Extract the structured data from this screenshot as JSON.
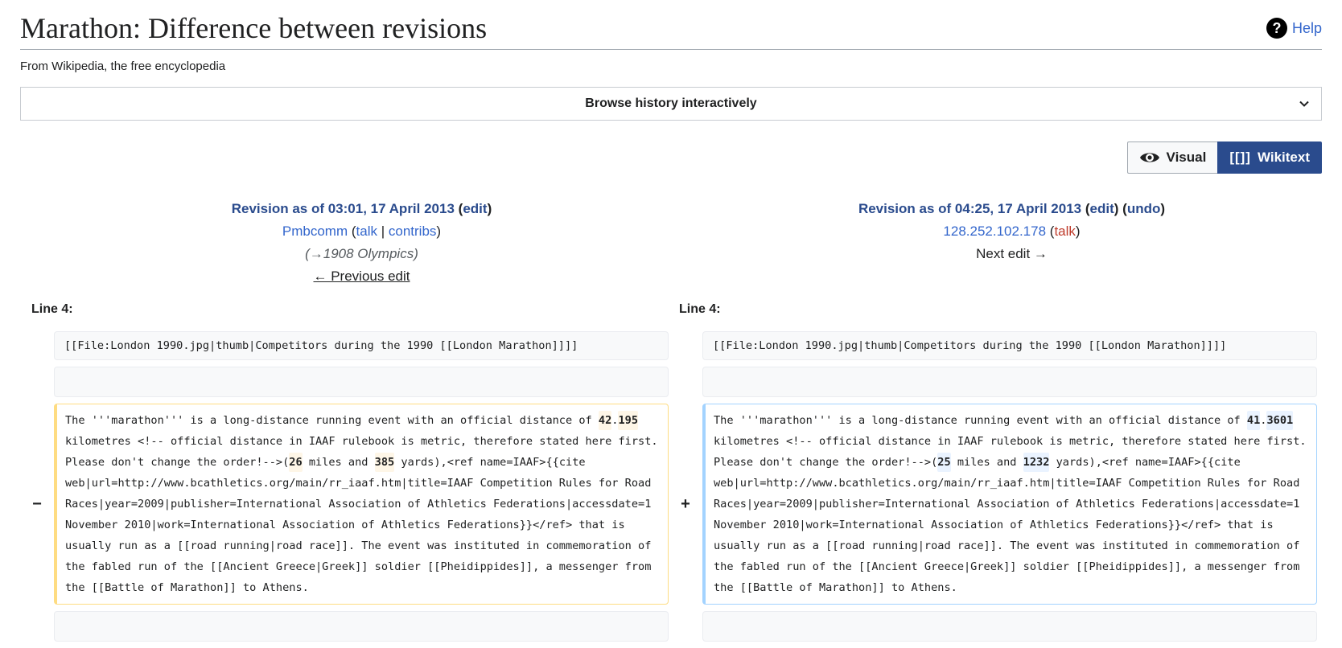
{
  "header": {
    "title": "Marathon: Difference between revisions",
    "help_label": "Help",
    "help_icon": "question-circle-icon",
    "tagline": "From Wikipedia, the free encyclopedia"
  },
  "browse_history": {
    "label": "Browse history interactively",
    "icon": "chevron-down-icon"
  },
  "mode_toggle": {
    "visual_label": "Visual",
    "visual_icon": "eye-icon",
    "wikitext_icon_text": "[[]]",
    "wikitext_label": "Wikitext",
    "selected": "Wikitext"
  },
  "old_revision": {
    "title": "Revision as of 03:01, 17 April 2013",
    "edit_label": "edit",
    "user": "Pmbcomm",
    "talk_label": "talk",
    "separator": "|",
    "contribs_label": "contribs",
    "summary": "(→1908 Olympics)",
    "nav_label": "← Previous edit"
  },
  "new_revision": {
    "title": "Revision as of 04:25, 17 April 2013",
    "edit_label": "edit",
    "undo_label": "undo",
    "user": "128.252.102.178",
    "talk_label": "talk",
    "nav_label": "Next edit →"
  },
  "diff": {
    "left_line_label": "Line 4:",
    "right_line_label": "Line 4:",
    "context_line": "[[File:London 1990.jpg|thumb|Competitors during the 1990 [[London Marathon]]]]",
    "deleted_marker": "−",
    "added_marker": "+",
    "deleted": {
      "t1": "The '''marathon''' is a long-distance running event with an official distance of ",
      "w1": "42",
      "t2": ".",
      "w2": "195",
      "t3": " kilometres <!-- official distance in IAAF rulebook is metric, therefore stated here first. Please don't change the order!-->(",
      "w3": "26",
      "t4": " miles and ",
      "w4": "385",
      "t5": " yards),<ref name=IAAF>{{cite web|url=http://www.bcathletics.org/main/rr_iaaf.htm|title=IAAF Competition Rules for Road Races|year=2009|publisher=International Association of Athletics Federations|accessdate=1 November 2010|work=International Association of Athletics Federations}}</ref> that is usually run as a [[road running|road race]]. The event was instituted in commemoration of the fabled run of the [[Ancient Greece|Greek]] soldier [[Pheidippides]], a messenger from the [[Battle of Marathon]] to Athens."
    },
    "added": {
      "t1": "The '''marathon''' is a long-distance running event with an official distance of ",
      "w1": "41",
      "t2": ".",
      "w2": "3601",
      "t3": " kilometres <!-- official distance in IAAF rulebook is metric, therefore stated here first. Please don't change the order!-->(",
      "w3": "25",
      "t4": " miles and ",
      "w4": "1232",
      "t5": " yards),<ref name=IAAF>{{cite web|url=http://www.bcathletics.org/main/rr_iaaf.htm|title=IAAF Competition Rules for Road Races|year=2009|publisher=International Association of Athletics Federations|accessdate=1 November 2010|work=International Association of Athletics Federations}}</ref> that is usually run as a [[road running|road race]]. The event was instituted in commemoration of the fabled run of the [[Ancient Greece|Greek]] soldier [[Pheidippides]], a messenger from the [[Battle of Marathon]] to Athens."
    }
  },
  "colors": {
    "link": "#3366cc",
    "link_dark": "#2a4b8d",
    "talk_red": "#bf3c2c",
    "deleted_border": "#fedc82",
    "deleted_highlight": "#fef6e7",
    "added_border": "#a3d3ff",
    "added_highlight": "#eaf3ff",
    "wikitext_button": "#2a4b8d"
  }
}
